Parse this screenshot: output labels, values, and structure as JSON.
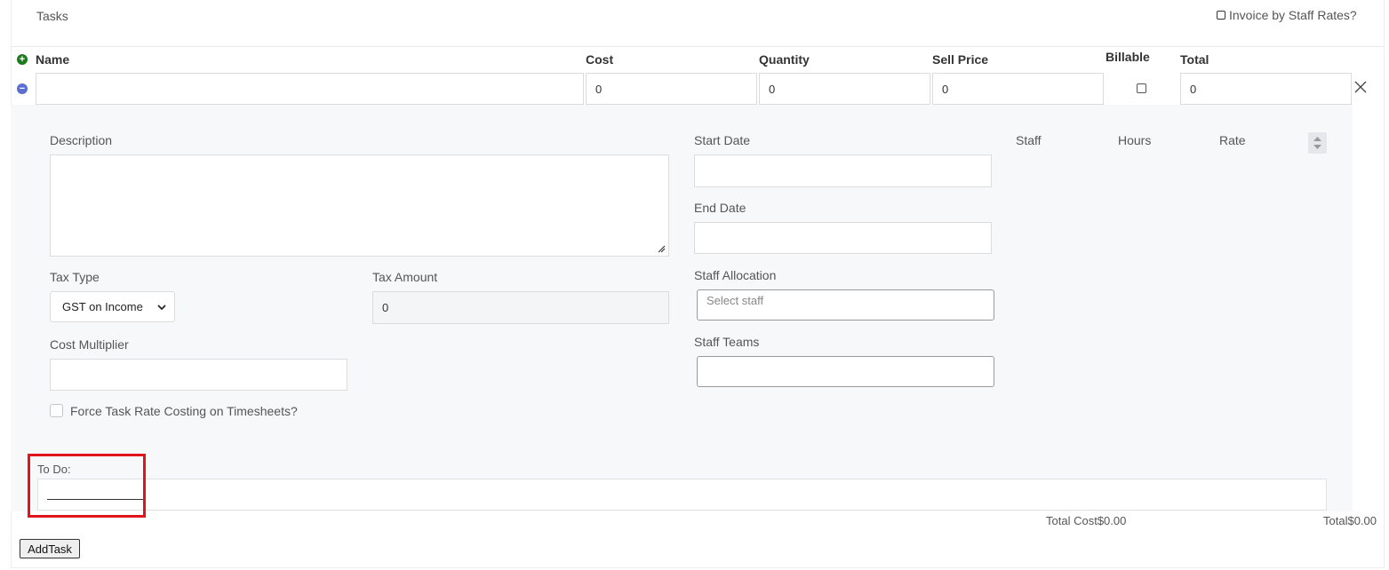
{
  "header": {
    "title": "Tasks",
    "invoice_by_staff_rates_label": "Invoice by Staff Rates?"
  },
  "columns": {
    "name": "Name",
    "cost": "Cost",
    "quantity": "Quantity",
    "sell_price": "Sell Price",
    "billable": "Billable",
    "total": "Total"
  },
  "task_row": {
    "name_value": "",
    "cost_value": "0",
    "quantity_value": "0",
    "sell_price_value": "0",
    "billable_checked": false,
    "total_value": "0"
  },
  "details": {
    "description_label": "Description",
    "start_date_label": "Start Date",
    "end_date_label": "End Date",
    "staff_col_label": "Staff",
    "hours_col_label": "Hours",
    "rate_col_label": "Rate",
    "tax_type_label": "Tax Type",
    "tax_type_value": "GST on Income",
    "tax_amount_label": "Tax Amount",
    "tax_amount_value": "0",
    "staff_allocation_label": "Staff Allocation",
    "staff_allocation_placeholder": "Select staff",
    "staff_teams_label": "Staff Teams",
    "cost_multiplier_label": "Cost Multiplier",
    "force_rate_label": "Force Task Rate Costing on Timesheets?",
    "todo_label": "To Do:"
  },
  "footer": {
    "total_cost_label": "Total Cost",
    "total_cost_value": "$0.00",
    "total_label": "Total",
    "total_value": "$0.00",
    "add_task_label": "AddTask"
  },
  "icons": {
    "add": "plus-circle-icon",
    "remove": "minus-circle-icon",
    "close": "close-icon",
    "chevron": "chevron-down-icon",
    "spinner": "spinner-arrows-icon"
  },
  "colors": {
    "add_button": "#1e7a1e",
    "remove_button": "#5a6fd0",
    "highlight": "#e0141b",
    "panel_bg": "#f7f8fa"
  }
}
